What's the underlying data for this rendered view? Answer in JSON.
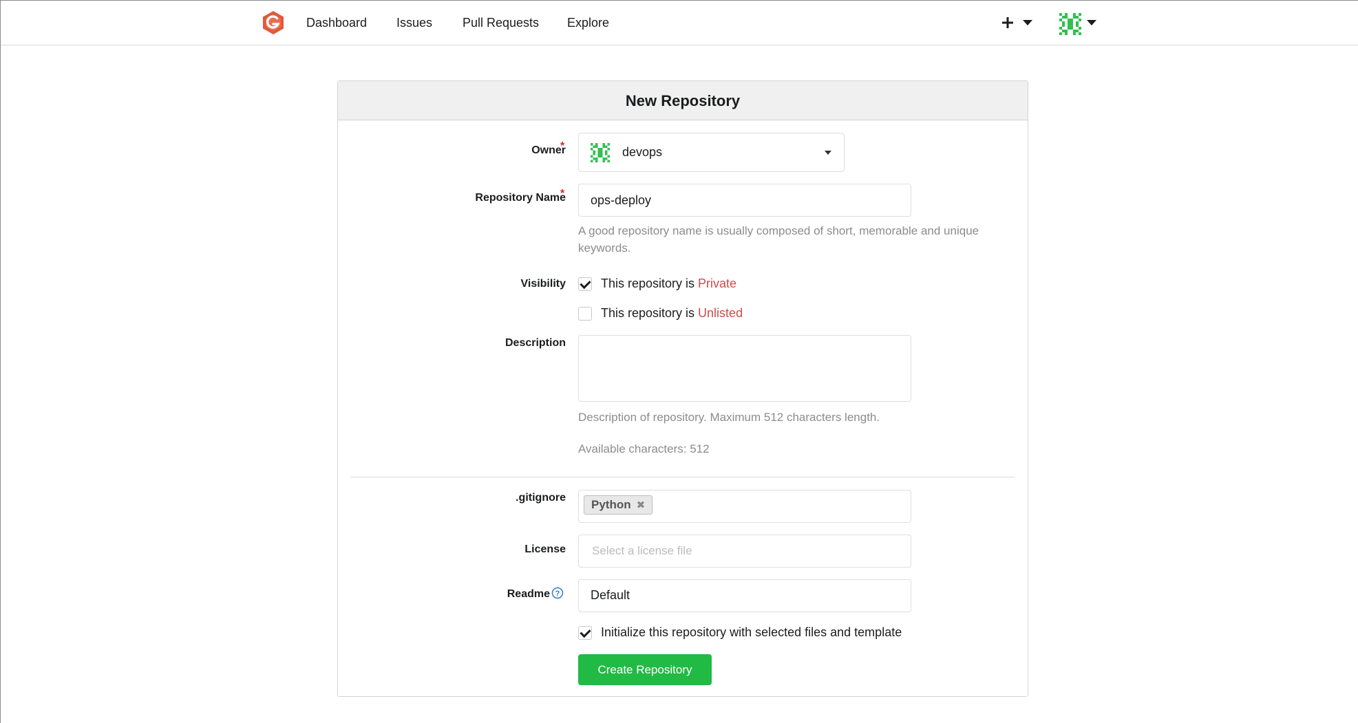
{
  "nav": {
    "dashboard": "Dashboard",
    "issues": "Issues",
    "pull_requests": "Pull Requests",
    "explore": "Explore"
  },
  "form": {
    "title": "New Repository",
    "owner_label": "Owner",
    "owner_value": "devops",
    "repo_name_label": "Repository Name",
    "repo_name_value": "ops-deploy",
    "repo_name_help": "A good repository name is usually composed of short, memorable and unique keywords.",
    "visibility_label": "Visibility",
    "private_prefix": "This repository is ",
    "private_word": "Private",
    "private_checked": true,
    "unlisted_prefix": "This repository is ",
    "unlisted_word": "Unlisted",
    "unlisted_checked": false,
    "description_label": "Description",
    "description_value": "",
    "description_help": "Description of repository. Maximum 512 characters length.",
    "available_chars": "Available characters: 512",
    "gitignore_label": ".gitignore",
    "gitignore_tag": "Python",
    "license_label": "License",
    "license_placeholder": "Select a license file",
    "readme_label": "Readme",
    "readme_value": "Default",
    "init_label": "Initialize this repository with selected files and template",
    "init_checked": true,
    "create_button": "Create Repository"
  },
  "colors": {
    "accent_green": "#21ba45",
    "required_red": "#db2828",
    "visibility_red": "#cf4a4a",
    "logo_orange": "#e05a3a",
    "avatar_green": "#30c050"
  },
  "icons": [
    "gitea-logo-icon",
    "plus-icon",
    "chevron-down-icon",
    "avatar-identicon",
    "dropdown-caret-icon",
    "close-icon",
    "question-circle-icon",
    "checkmark-icon"
  ]
}
